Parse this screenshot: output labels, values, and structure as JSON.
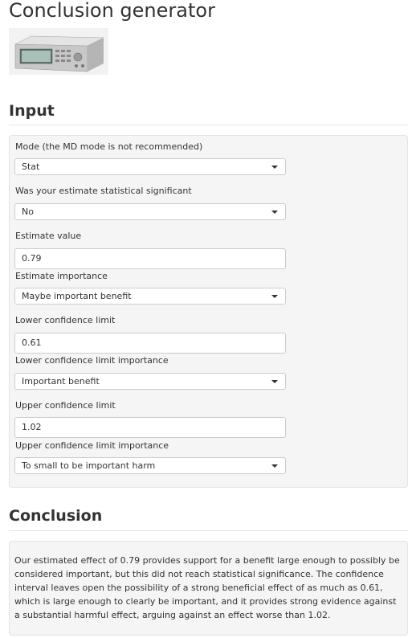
{
  "page": {
    "title": "Conclusion generator",
    "image_alt": "signal-generator-device-image"
  },
  "input_section": {
    "title": "Input",
    "fields": {
      "mode": {
        "label": "Mode (the MD mode is not recommended)",
        "value": "Stat"
      },
      "significant": {
        "label": "Was your estimate statistical significant",
        "value": "No"
      },
      "estimate_value": {
        "label": "Estimate value",
        "value": "0.79"
      },
      "estimate_importance": {
        "label": "Estimate importance",
        "value": "Maybe important benefit"
      },
      "lower_limit": {
        "label": "Lower confidence limit",
        "value": "0.61"
      },
      "lower_importance": {
        "label": "Lower confidence limit importance",
        "value": "Important benefit"
      },
      "upper_limit": {
        "label": "Upper confidence limit",
        "value": "1.02"
      },
      "upper_importance": {
        "label": "Upper confidence limit importance",
        "value": "To small to be important harm"
      }
    }
  },
  "conclusion_section": {
    "title": "Conclusion",
    "text": "Our estimated effect of 0.79 provides support for a benefit large enough to possibly be considered important, but this did not reach statistical significance. The confidence interval leaves open the possibility of a strong beneficial effect of as much as 0.61, which is large enough to clearly be important, and it provides strong evidence against a substantial harmful effect, arguing against an effect worse than 1.02."
  }
}
